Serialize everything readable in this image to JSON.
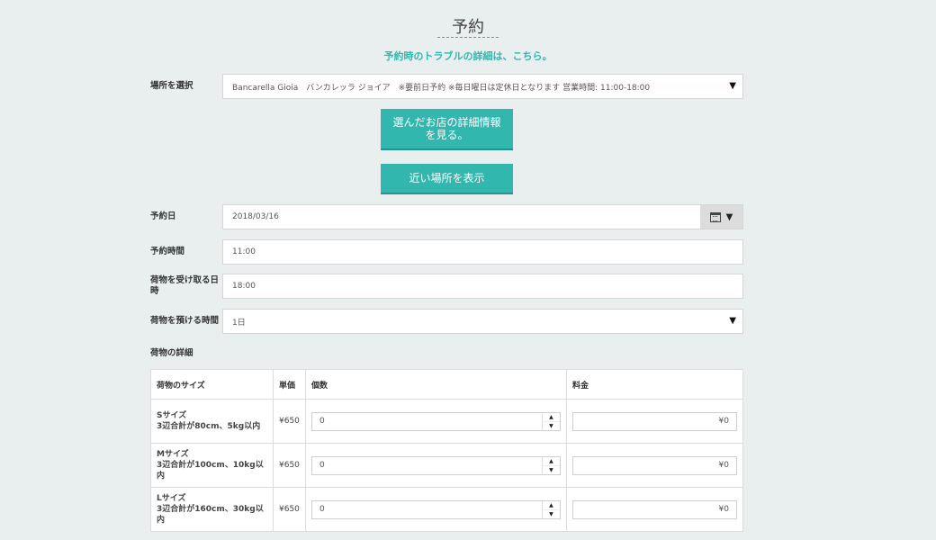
{
  "header": {
    "title": "予約",
    "trouble_link": "予約時のトラブルの詳細は、こちら。"
  },
  "location": {
    "label": "場所を選択",
    "selected": "Bancarella Gioia　バンカレッラ ジョイア　※要前日予約 ※毎日曜日は定休日となります 営業時間: 11:00-18:00"
  },
  "buttons": {
    "store_details": "選んだお店の詳細情報を見る。",
    "nearby": "近い場所を表示"
  },
  "reservation": {
    "date_label": "予約日",
    "date_value": "2018/03/16",
    "time_label": "予約時間",
    "time_value": "11:00",
    "pickup_label": "荷物を受け取る日時",
    "pickup_value": "18:00",
    "duration_label": "荷物を預ける時間",
    "duration_value": "1日"
  },
  "luggage": {
    "section_label": "荷物の詳細",
    "columns": [
      "荷物のサイズ",
      "単価",
      "個数",
      "料金"
    ],
    "rows": [
      {
        "size": "Sサイズ",
        "desc": "3辺合計が80cm、5kg以内",
        "price": "¥650",
        "qty": "0",
        "fee": "¥0"
      },
      {
        "size": "Mサイズ",
        "desc": "3辺合計が100cm、10kg以内",
        "price": "¥650",
        "qty": "0",
        "fee": "¥0"
      },
      {
        "size": "Lサイズ",
        "desc": "3辺合計が160cm、30kg以内",
        "price": "¥650",
        "qty": "0",
        "fee": "¥0"
      }
    ]
  },
  "icons": {
    "dropdown": "caret-down-icon",
    "calendar": "calendar-icon",
    "spinner_up": "spinner-up-icon",
    "spinner_down": "spinner-down-icon"
  },
  "colors": {
    "background": "#e8efee",
    "accent": "#31b7ad"
  }
}
